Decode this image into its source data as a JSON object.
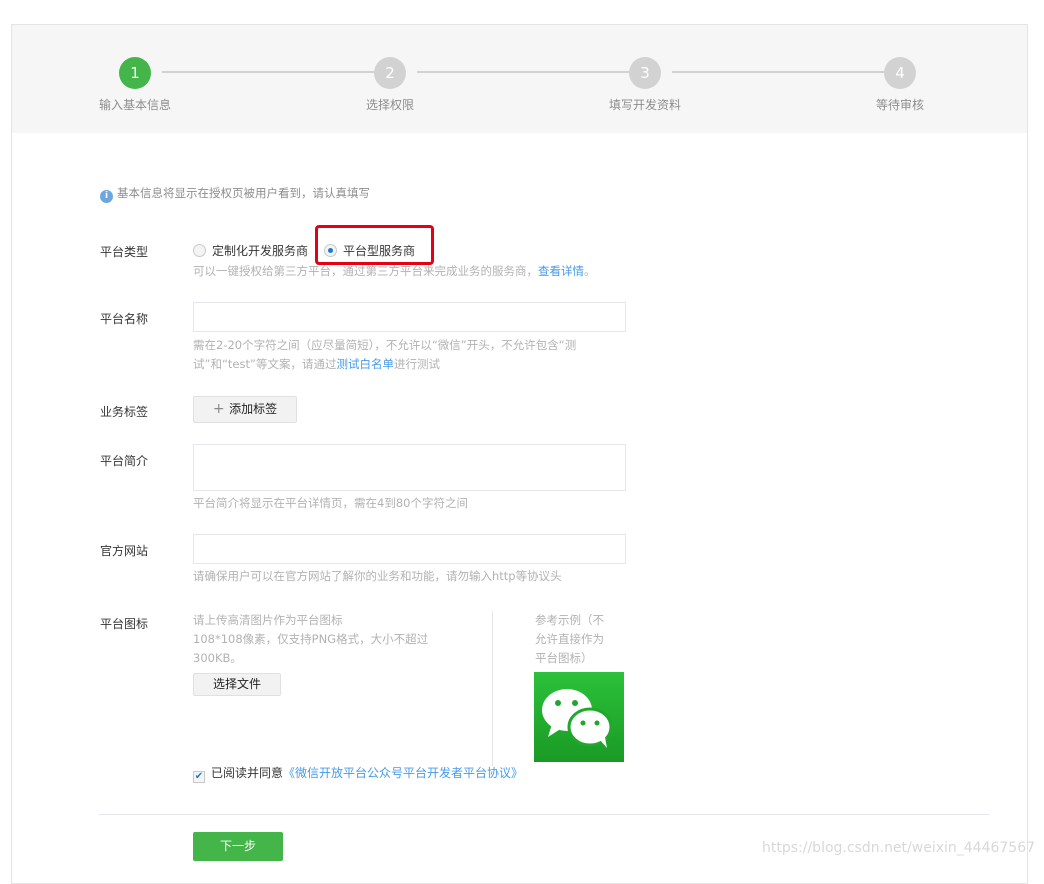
{
  "steps": [
    {
      "num": "1",
      "label": "输入基本信息",
      "active": true
    },
    {
      "num": "2",
      "label": "选择权限"
    },
    {
      "num": "3",
      "label": "填写开发资料"
    },
    {
      "num": "4",
      "label": "等待审核"
    }
  ],
  "notice": "基本信息将显示在授权页被用户看到，请认真填写",
  "platform_type": {
    "label": "平台类型",
    "options": [
      "定制化开发服务商",
      "平台型服务商"
    ],
    "selected": "平台型服务商",
    "tip": "可以一键授权给第三方平台，通过第三方平台来完成业务的服务商，",
    "tip_link": "查看详情",
    "tip_end": "。"
  },
  "platform_name": {
    "label": "平台名称",
    "value": "",
    "tip1": "需在2-20个字符之间（应尽量简短），不允许以“微信”开头，不允许包含“测",
    "tip2": "试”和“test”等文案，请通过",
    "tip_link": "测试白名单",
    "tip_end": "进行测试"
  },
  "business_tags": {
    "label": "业务标签",
    "button": "添加标签"
  },
  "intro": {
    "label": "平台简介",
    "value": "",
    "tip": "平台简介将显示在平台详情页，需在4到80个字符之间"
  },
  "website": {
    "label": "官方网站",
    "value": "",
    "tip": "请确保用户可以在官方网站了解你的业务和功能，请勿输入http等协议头"
  },
  "icon": {
    "label": "平台图标",
    "desc1": "请上传高清图片作为平台图标",
    "desc2": "108*108像素，仅支持PNG格式，大小不超过",
    "desc3": "300KB。",
    "button": "选择文件",
    "example1": "参考示例（不",
    "example2": "允许直接作为",
    "example3": "平台图标）"
  },
  "agreement": {
    "checked": true,
    "text": "已阅读并同意",
    "link": "《微信开放平台公众号平台开发者平台协议》"
  },
  "next_button": "下一步",
  "watermark": "https://blog.csdn.net/weixin_44467567",
  "colors": {
    "accent": "#44b549",
    "link": "#459ae9",
    "highlight": "#e60012"
  }
}
